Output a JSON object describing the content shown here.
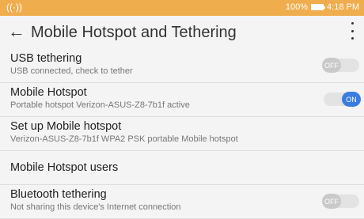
{
  "status": {
    "time": "4:18 PM",
    "battery": "100%",
    "signal_icon": "hotspot-signal-icon"
  },
  "app_bar": {
    "title": "Mobile Hotspot and Tethering"
  },
  "items": [
    {
      "title": "USB tethering",
      "subtitle": "USB connected, check to tether",
      "toggle": "OFF"
    },
    {
      "title": "Mobile Hotspot",
      "subtitle": "Portable hotspot Verizon-ASUS-Z8-7b1f active",
      "toggle": "ON"
    },
    {
      "title": "Set up Mobile hotspot",
      "subtitle": "Verizon-ASUS-Z8-7b1f WPA2 PSK portable Mobile hotspot"
    },
    {
      "title": "Mobile Hotspot users"
    },
    {
      "title": "Bluetooth tethering",
      "subtitle": "Not sharing this device's Internet connection",
      "toggle": "OFF"
    }
  ],
  "colors": {
    "status_bar": "#f0ad4e",
    "toggle_on": "#3a7de0"
  }
}
